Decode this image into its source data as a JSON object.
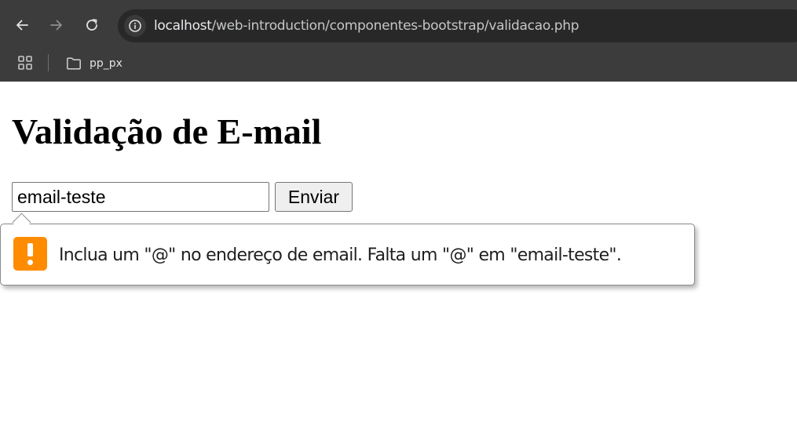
{
  "browser": {
    "url_host": "localhost",
    "url_path": "/web-introduction/componentes-bootstrap/validacao.php",
    "bookmarks": [
      {
        "label": "pp_px"
      }
    ],
    "icons": {
      "back": "back-arrow-icon",
      "forward": "forward-arrow-icon",
      "reload": "reload-icon",
      "site_info": "site-info-icon",
      "apps": "apps-grid-icon",
      "folder": "folder-icon"
    },
    "colors": {
      "toolbar": "#3c3c3c",
      "omnibox": "#282828"
    }
  },
  "page": {
    "title": "Validação de E-mail",
    "email_input": {
      "value": "email-teste",
      "placeholder": ""
    },
    "submit_label": "Enviar"
  },
  "validation_tooltip": {
    "message": "Inclua um \"@\" no endereço de email. Falta um \"@\" em \"email-teste\".",
    "icon": "warning-icon",
    "icon_color": "#ff8c00"
  }
}
